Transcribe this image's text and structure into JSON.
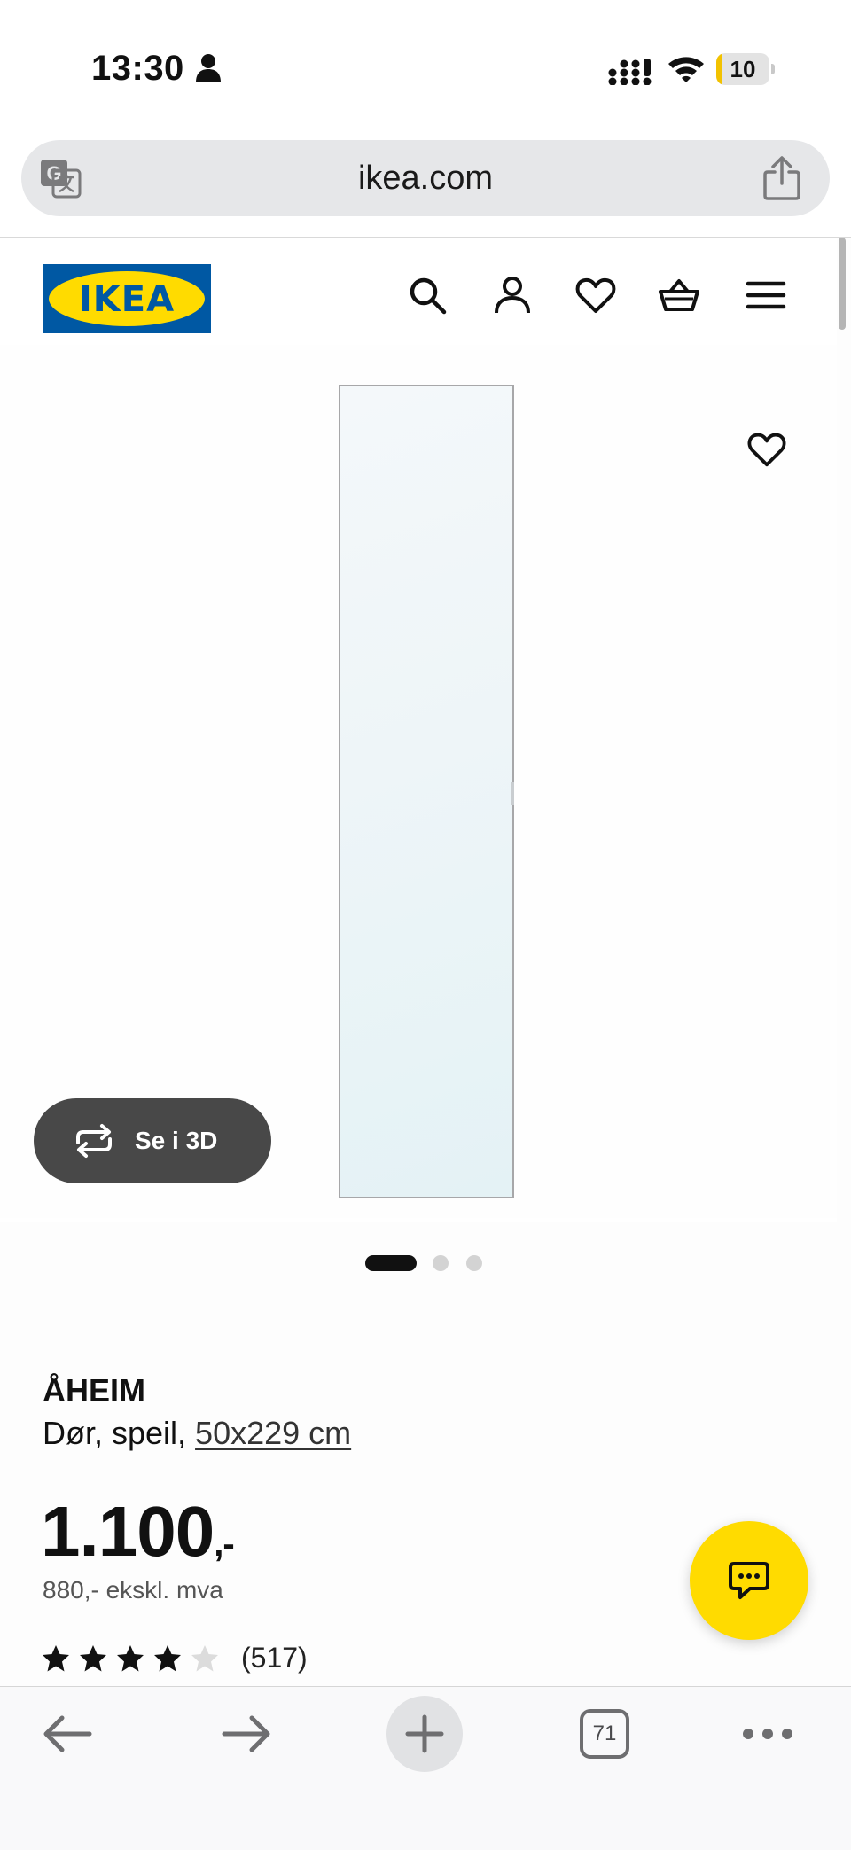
{
  "status_bar": {
    "time": "13:30",
    "battery_level": "10",
    "battery_fraction": 0.1
  },
  "browser": {
    "url": "ikea.com",
    "open_tabs_count": "71"
  },
  "site_header": {
    "logo_text": "IKEA",
    "icons": [
      "search-icon",
      "account-icon",
      "heart-icon",
      "basket-icon",
      "menu-icon"
    ]
  },
  "gallery": {
    "view_3d_label": "Se i 3D",
    "image_count": 3,
    "active_image": 1
  },
  "product": {
    "name": "ÅHEIM",
    "type": "Dør, speil, ",
    "size": "50x229 cm",
    "price": "1.100",
    "price_suffix": ",-",
    "price_ex_vat": "880,- ekskl. mva",
    "rating_stars": 4,
    "rating_max": 5,
    "review_count": "(517)"
  },
  "colors": {
    "ikea_blue": "#0058a3",
    "ikea_yellow": "#ffdb00",
    "text_primary": "#111111",
    "view_3d_bg": "#484848"
  }
}
